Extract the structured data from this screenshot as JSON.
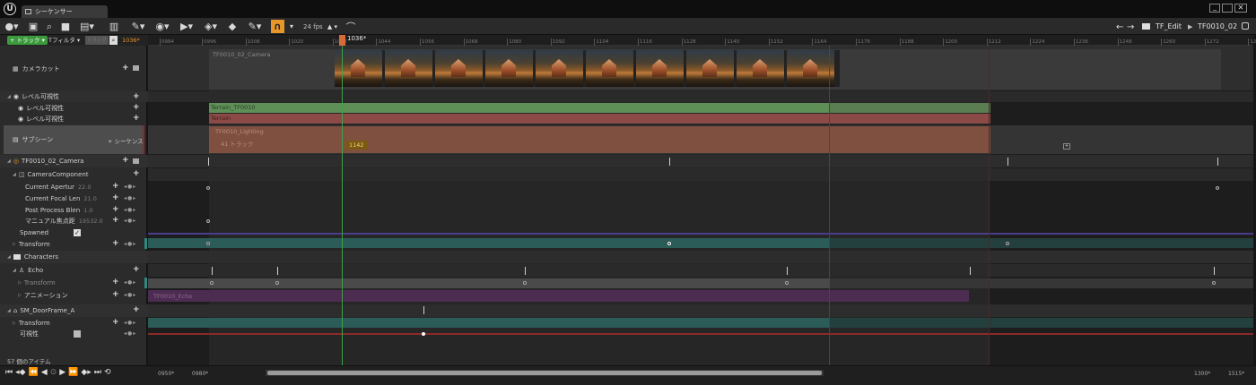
{
  "window": {
    "tab_title": "シーケンサー"
  },
  "toolbar": {
    "fps": "24 fps",
    "breadcrumb_1": "TF_Edit",
    "breadcrumb_2": "TF0010_02",
    "back_arrow": "←",
    "forward_arrow": "→",
    "separator": "▶"
  },
  "filterbar": {
    "add_track": "+ トラック ▾",
    "filter": "Tフィルタ ▾",
    "search_placeholder": "トラック",
    "current_time": "1036*"
  },
  "playhead": {
    "label": "1036*",
    "frame": 1036
  },
  "ruler": {
    "ticks": [
      "0996",
      "1008",
      "1020",
      "1032",
      "1044",
      "1056",
      "1068",
      "1080",
      "1092",
      "1104",
      "1116",
      "1128",
      "1140",
      "1152",
      "1164",
      "1176",
      "1188",
      "1200",
      "1212",
      "1224",
      "1236",
      "1248",
      "1260",
      "1272",
      "1284",
      "1296"
    ],
    "first_label": "0984"
  },
  "tracks": {
    "camera_cut": "カメラカット",
    "level_visibility": "レベル可視性",
    "level_vis_1": "レベル可視性",
    "level_vis_2": "レベル可視性",
    "subscene": "サブシーン",
    "subscene_add": "+ シーケンス",
    "camera_actor": "TF0010_02_Camera",
    "camera_component": "CameraComponent",
    "aperture": "Current Apertur",
    "aperture_val": "22.0",
    "focal": "Current Focal Len",
    "focal_val": "21.0",
    "post_process": "Post Process Blen",
    "post_process_val": "1.0",
    "manual_focus": "マニュアル焦点距",
    "manual_focus_val": "19532.0",
    "spawned": "Spawned",
    "transform": "Transform",
    "characters": "Characters",
    "echo": "Echo",
    "echo_transform": "Transform",
    "animation": "アニメーション",
    "door": "SM_DoorFrame_A",
    "door_transform": "Transform",
    "visibility": "可視性"
  },
  "sections": {
    "camera_shot": "TF0010_02_Camera",
    "terrain_tf": "Terrain_TF0010",
    "terrain": "Terrain",
    "lighting": "TF0010_Lighting",
    "lighting_tracks": "41 トラック",
    "frame_marker": "1142",
    "echo_anim": "TF0010_Echo"
  },
  "footer": {
    "item_count": "57 個のアイテム",
    "range_start": "0950*",
    "range_in": "0980*",
    "range_out": "1300*",
    "range_end": "1515*"
  },
  "colors": {
    "green_bar": "#5d8f56",
    "red_bar": "#8c4a47",
    "lighting_bar": "#7f4f40",
    "teal_bar": "#2c5c57",
    "purple_bar": "#4d2c52",
    "playhead": "#d86b3a",
    "accent_green": "#3ca24a"
  }
}
